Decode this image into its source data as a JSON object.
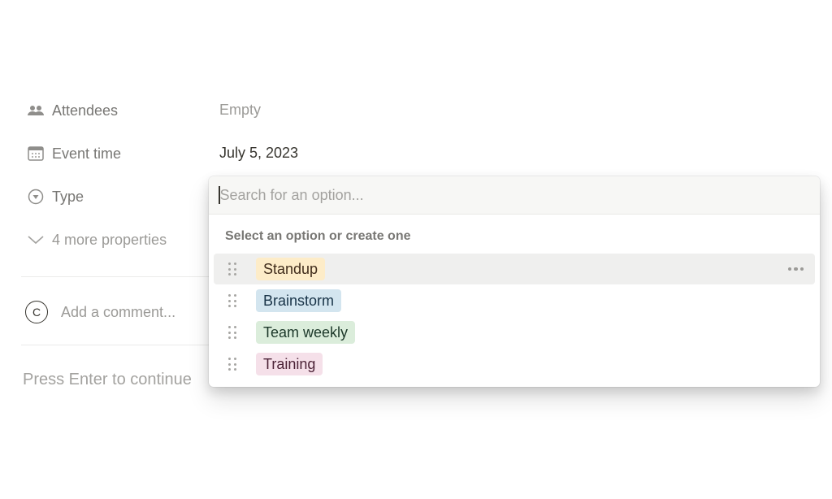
{
  "properties": [
    {
      "icon": "people-icon",
      "label": "Attendees",
      "value": "Empty",
      "empty": true
    },
    {
      "icon": "calendar-icon",
      "label": "Event time",
      "value": "July 5, 2023",
      "empty": false
    },
    {
      "icon": "select-icon",
      "label": "Type",
      "value": "",
      "empty": true
    }
  ],
  "more_properties": {
    "icon": "chevron-down-icon",
    "label": "4 more properties"
  },
  "comment": {
    "avatar_initial": "C",
    "placeholder": "Add a comment..."
  },
  "continue_hint": "Press Enter to continue",
  "dropdown": {
    "search_placeholder": "Search for an option...",
    "search_value": "",
    "section_label": "Select an option or create one",
    "options": [
      {
        "label": "Standup",
        "bg": "#fdecc8",
        "fg": "#402c1b",
        "hovered": true
      },
      {
        "label": "Brainstorm",
        "bg": "#d3e5ef",
        "fg": "#183347",
        "hovered": false
      },
      {
        "label": "Team weekly",
        "bg": "#dbeddb",
        "fg": "#1c3829",
        "hovered": false
      },
      {
        "label": "Training",
        "bg": "#f5e0e9",
        "fg": "#4c2337",
        "hovered": false
      }
    ]
  }
}
